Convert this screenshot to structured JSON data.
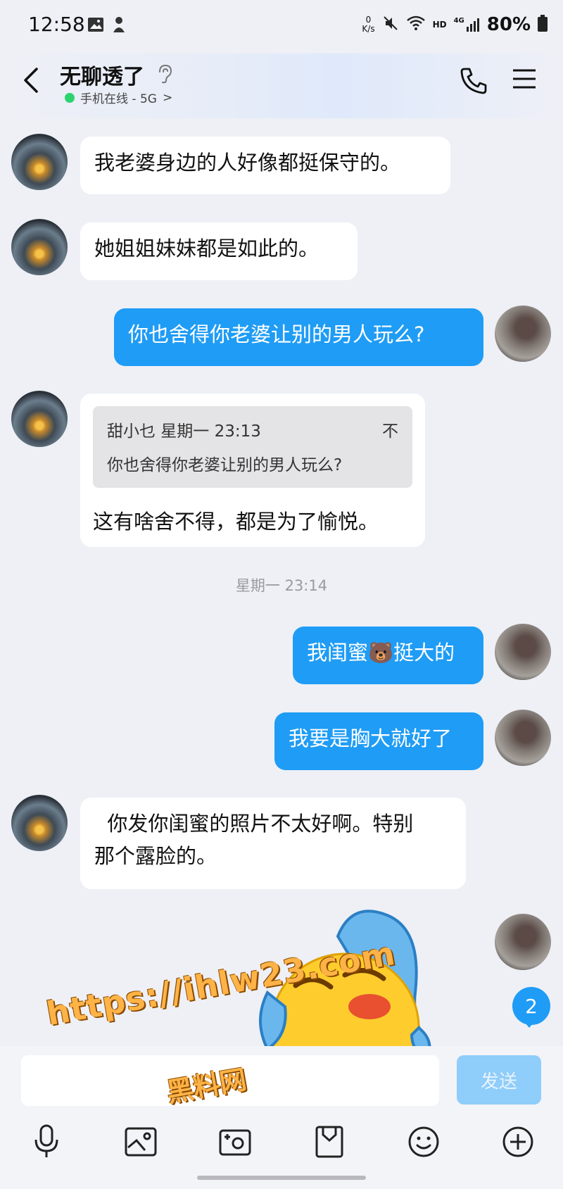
{
  "status_bar": {
    "time": "12:58",
    "net_speed_top": "0",
    "net_speed_unit": "K/s",
    "hd": "HD",
    "network": "4G",
    "battery": "80%"
  },
  "header": {
    "title": "无聊透了",
    "status": "手机在线 - 5G",
    "status_chevron": ">"
  },
  "messages": [
    {
      "side": "in",
      "text": "我老婆身边的人好像都挺保守的。"
    },
    {
      "side": "in",
      "text": "她姐姐妹妹都是如此的。"
    },
    {
      "side": "out",
      "text": "你也舍得你老婆让别的男人玩么?"
    },
    {
      "side": "in",
      "quote_author_time": "甜小乜  星期一 23:13",
      "quote_more": "不",
      "quote_text": "你也舍得你老婆让别的男人玩么?",
      "text": "这有啥舍不得，都是为了愉悦。"
    },
    {
      "side": "time",
      "text": "星期一 23:14"
    },
    {
      "side": "out",
      "text_a": "我闺蜜",
      "emoji": "🐻",
      "text_b": "挺大的"
    },
    {
      "side": "out",
      "text": "我要是胸大就好了"
    },
    {
      "side": "in",
      "text_line1": "  你发你闺蜜的照片不太好啊。特别",
      "text_line2": "那个露脸的。"
    },
    {
      "side": "out",
      "sticker": "crying-laughing-face-sticker"
    }
  ],
  "unread_badge": "2",
  "input": {
    "value": "",
    "send_label": "发送"
  },
  "toolbar": [
    "mic-icon",
    "image-icon",
    "camera-icon",
    "file-icon",
    "emoji-icon",
    "plus-icon"
  ],
  "watermark": {
    "line1": "https://ihlw23.com",
    "line2": "黑料网"
  },
  "colors": {
    "accent": "#1f9cf5",
    "background": "#eef0f6",
    "online": "#2dd36f"
  }
}
